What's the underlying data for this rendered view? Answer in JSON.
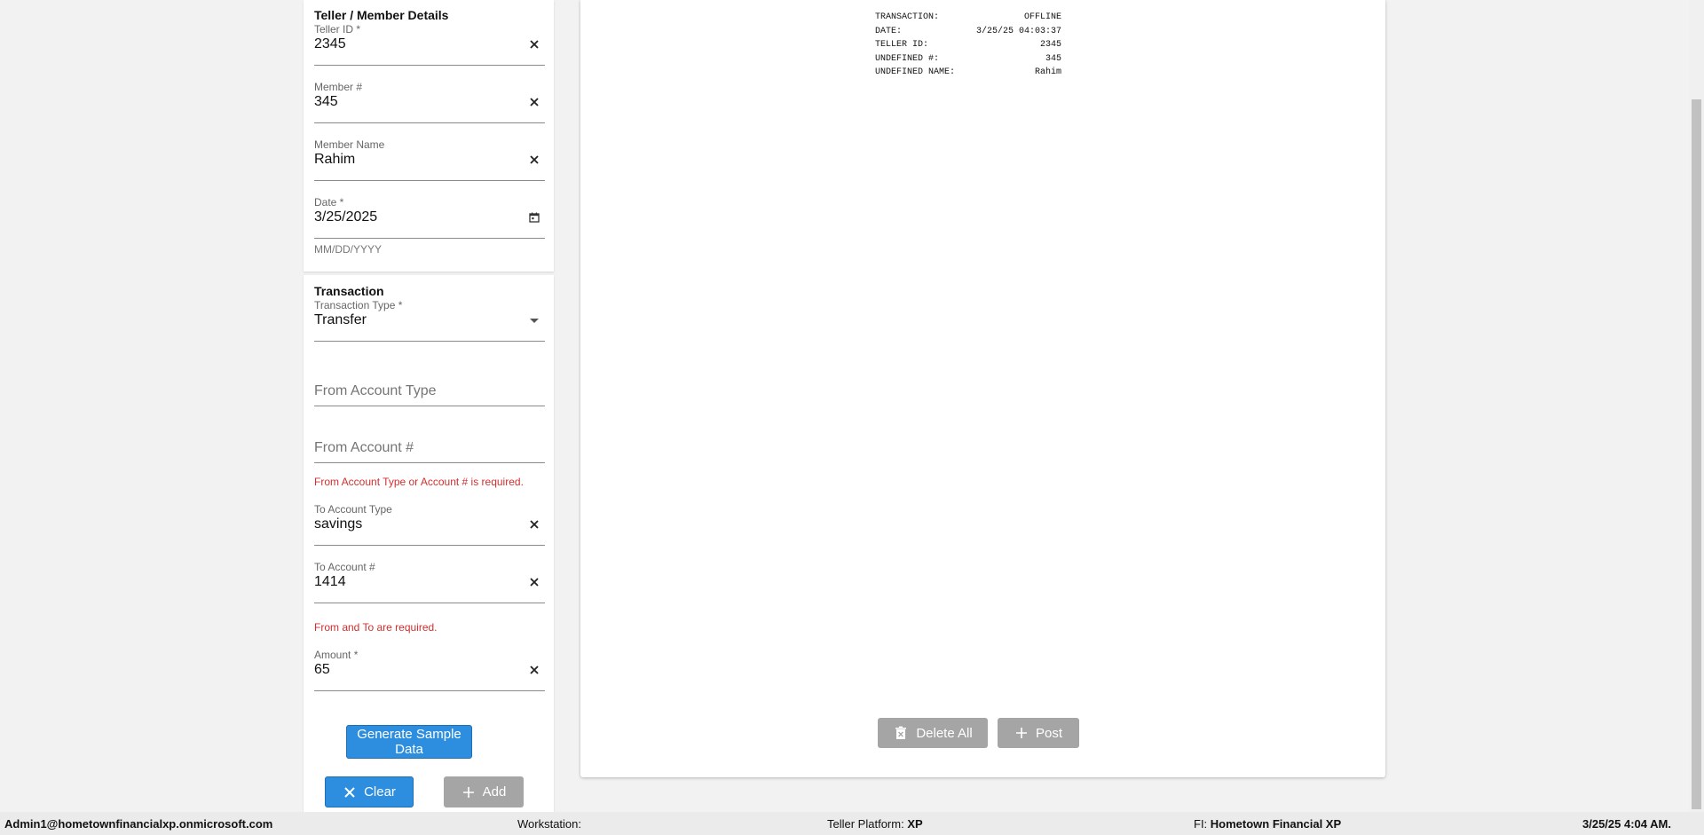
{
  "details": {
    "title": "Teller / Member Details",
    "teller_id": {
      "label": "Teller ID *",
      "value": "2345"
    },
    "member_number": {
      "label": "Member #",
      "value": "345"
    },
    "member_name": {
      "label": "Member Name",
      "value": "Rahim"
    },
    "date": {
      "label": "Date *",
      "value": "3/25/2025",
      "helper": "MM/DD/YYYY"
    }
  },
  "transaction": {
    "title": "Transaction",
    "type": {
      "label": "Transaction Type *",
      "value": "Transfer"
    },
    "from_account_type": {
      "placeholder": "From Account Type"
    },
    "from_account_number": {
      "placeholder": "From Account #"
    },
    "from_error": "From Account Type or Account # is required.",
    "to_account_type": {
      "label": "To Account Type",
      "value": "savings"
    },
    "to_account_number": {
      "label": "To Account #",
      "value": "1414"
    },
    "to_error": "From and To are required.",
    "amount": {
      "label": "Amount *",
      "value": "65"
    },
    "generate_label": "Generate Sample Data",
    "clear_label": "Clear",
    "add_label": "Add"
  },
  "receipt": {
    "rows": [
      {
        "key": "TRANSACTION:",
        "value": "OFFLINE"
      },
      {
        "key": "DATE:",
        "value": "3/25/25 04:03:37"
      },
      {
        "key": "TELLER ID:",
        "value": "2345"
      },
      {
        "key": "UNDEFINED #:",
        "value": "345"
      },
      {
        "key": "UNDEFINED NAME:",
        "value": "Rahim"
      }
    ],
    "delete_all_label": "Delete All",
    "post_label": "Post"
  },
  "status": {
    "user": "Admin1@hometownfinancialxp.onmicrosoft.com",
    "workstation_label": "Workstation:",
    "platform_label": "Teller Platform:",
    "platform_value": "XP",
    "fi_label": "FI:",
    "fi_value": "Hometown Financial XP",
    "datetime": "3/25/25 4:04 AM."
  },
  "colors": {
    "accent": "#2d8ee0",
    "error": "#d32f2f",
    "disabled": "#a5a5a5"
  }
}
